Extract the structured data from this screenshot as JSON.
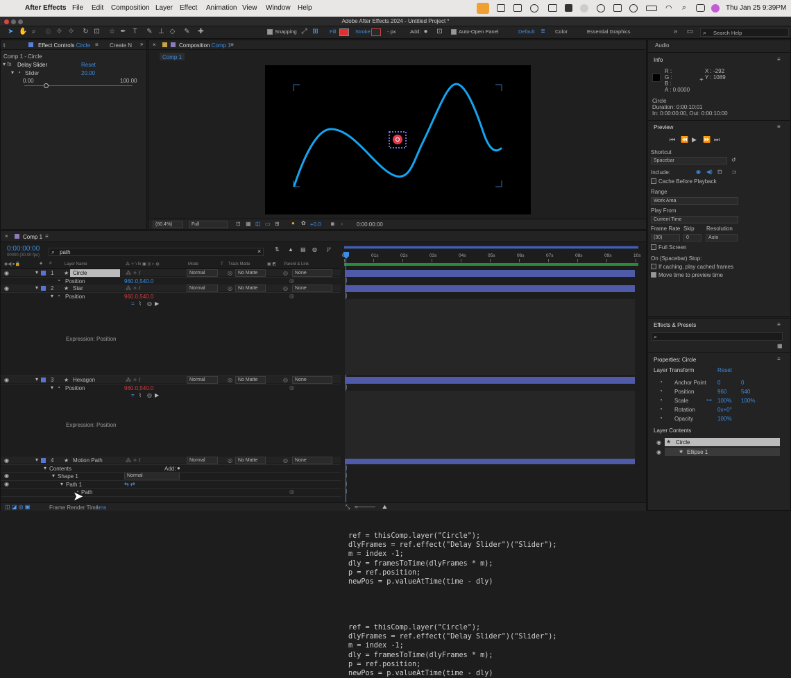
{
  "menubar": {
    "app": "After Effects",
    "items": [
      "File",
      "Edit",
      "Composition",
      "Layer",
      "Effect",
      "Animation",
      "View",
      "Window",
      "Help"
    ],
    "clock": "Thu Jan 25  9:39PM"
  },
  "window": {
    "title": "Adobe After Effects 2024 - Untitled Project *"
  },
  "toolbar": {
    "snapping": "Snapping",
    "fill": "Fill",
    "stroke": "Stroke",
    "stroke_px": "- px",
    "add": "Add:",
    "auto_open": "Auto-Open Panel",
    "workspace_default": "Default",
    "workspace_color": "Color",
    "workspace_eg": "Essential Graphics",
    "search_placeholder": "Search Help"
  },
  "effect_controls": {
    "tab_label": "Effect Controls",
    "tab_layer": "Circle",
    "other_tab": "Create N",
    "breadcrumb": "Comp 1 - Circle",
    "effect_name": "Delay Slider",
    "reset": "Reset",
    "slider_label": "Slider",
    "slider_value": "20.00",
    "slider_min": "0.00",
    "slider_max": "100.00",
    "slider_fraction": 0.2
  },
  "composition": {
    "tab_label": "Composition",
    "tab_comp": "Comp 1",
    "subtab": "Comp 1",
    "zoom": "(60.4%)",
    "resolution": "Full",
    "exposure": "+0.0",
    "timecode": "0:00:00:00"
  },
  "info": {
    "title": "Info",
    "r": "R :",
    "g": "G :",
    "b": "B :",
    "a": "A :  0.0000",
    "x": "X : -292",
    "y": "Y : 1089",
    "layer": "Circle",
    "duration": "Duration: 0:00:10:01",
    "inout": "In: 0:00:00:00, Out: 0:00:10:00"
  },
  "preview": {
    "title": "Preview",
    "shortcut_label": "Shortcut",
    "shortcut": "Spacebar",
    "include": "Include:",
    "cache": "Cache Before Playback",
    "range_label": "Range",
    "range": "Work Area",
    "playfrom_label": "Play From",
    "playfrom": "Current Time",
    "framerate_label": "Frame Rate",
    "skip_label": "Skip",
    "resolution_label": "Resolution",
    "framerate": "(30)",
    "skip": "0",
    "resolution": "Auto",
    "fullscreen": "Full Screen",
    "stop_label": "On (Spacebar) Stop:",
    "if_caching": "If caching, play cached frames",
    "move_time": "Move time to preview time"
  },
  "effects_presets": {
    "title": "Effects & Presets",
    "search": ""
  },
  "properties": {
    "title": "Properties: Circle",
    "section": "Layer Transform",
    "reset": "Reset",
    "rows": [
      {
        "name": "Anchor Point",
        "v1": "0",
        "v2": "0"
      },
      {
        "name": "Position",
        "v1": "960",
        "v2": "540"
      },
      {
        "name": "Scale",
        "v1": "100%",
        "v2": "100%"
      },
      {
        "name": "Rotation",
        "v1": "0x+0°",
        "v2": ""
      },
      {
        "name": "Opacity",
        "v1": "100%",
        "v2": ""
      }
    ],
    "contents_title": "Layer Contents",
    "contents": [
      "Circle",
      "Ellipse 1"
    ]
  },
  "timeline": {
    "tab": "Comp 1",
    "timecode": "0:00:00:00",
    "fps": "00000 (30.00 fps)",
    "search": "path",
    "col_layer": "Layer Name",
    "col_mode": "Mode",
    "col_t": "T",
    "col_track": "Track Matte",
    "col_parent": "Parent & Link",
    "ruler": [
      "0s",
      "01s",
      "02s",
      "03s",
      "04s",
      "05s",
      "06s",
      "07s",
      "08s",
      "09s",
      "10s"
    ],
    "layers": [
      {
        "num": "1",
        "name": "Circle",
        "mode": "Normal",
        "matte": "No Matte",
        "parent": "None"
      },
      {
        "num": "2",
        "name": "Star",
        "mode": "Normal",
        "matte": "No Matte",
        "parent": "None"
      },
      {
        "num": "3",
        "name": "Hexagon",
        "mode": "Normal",
        "matte": "No Matte",
        "parent": "None"
      },
      {
        "num": "4",
        "name": "Motion Path",
        "mode": "Normal",
        "matte": "No Matte",
        "parent": "None"
      }
    ],
    "position_label": "Position",
    "pos1": "960.0,540.0",
    "pos2": "960.0,540.0",
    "pos3": "960.0,540.0",
    "expr_label": "Expression: Position",
    "expr_lines": [
      "ref = thisComp.layer(\"Circle\");",
      "dlyFrames = ref.effect(\"Delay Slider\")(\"Slider\");",
      "m = index -1;",
      "dly = framesToTime(dlyFrames * m);",
      "p = ref.position;",
      "newPos = p.valueAtTime(time - dly)"
    ],
    "contents": "Contents",
    "add": "Add:",
    "shape1": "Shape 1",
    "shape_mode": "Normal",
    "path1": "Path 1",
    "path": "Path",
    "render_label": "Frame Render Time",
    "render_value": "1ms"
  }
}
